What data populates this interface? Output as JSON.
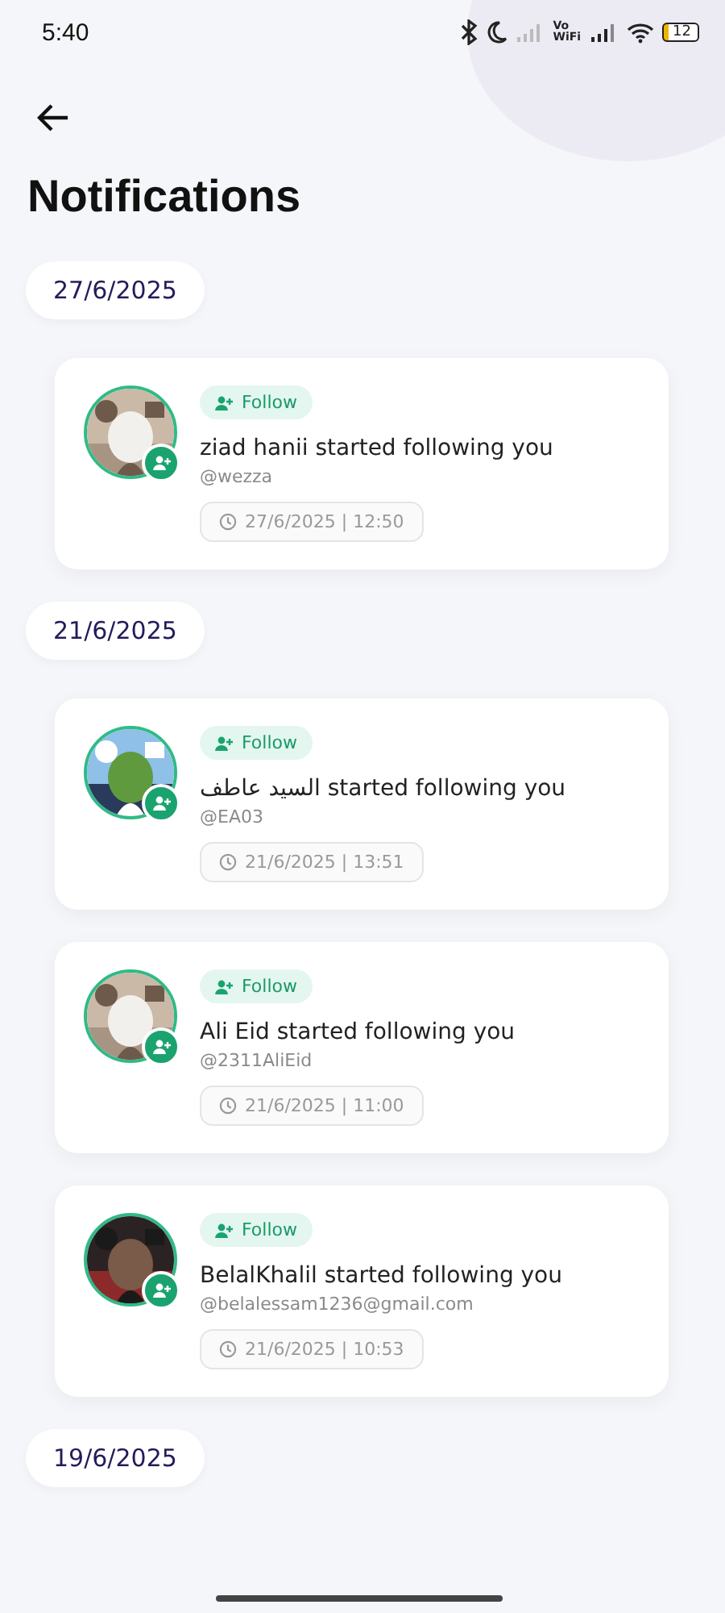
{
  "status_bar": {
    "time": "5:40",
    "volte_top": "Vo",
    "volte_bottom": "WiFi",
    "battery": "12"
  },
  "title": "Notifications",
  "groups": [
    {
      "date": "27/6/2025",
      "items": [
        {
          "badge": "Follow",
          "message": "ziad hanii started following you",
          "handle": "@wezza",
          "time": "27/6/2025 | 12:50"
        }
      ]
    },
    {
      "date": "21/6/2025",
      "items": [
        {
          "badge": "Follow",
          "message": "السيد عاطف started following you",
          "handle": "@EA03",
          "time": "21/6/2025 | 13:51"
        },
        {
          "badge": "Follow",
          "message": "Ali Eid started following you",
          "handle": "@2311AliEid",
          "time": "21/6/2025 | 11:00"
        },
        {
          "badge": "Follow",
          "message": "BelalKhalil started following you",
          "handle": "@belalessam1236@gmail.com",
          "time": "21/6/2025 | 10:53"
        }
      ]
    },
    {
      "date": "19/6/2025"
    }
  ]
}
